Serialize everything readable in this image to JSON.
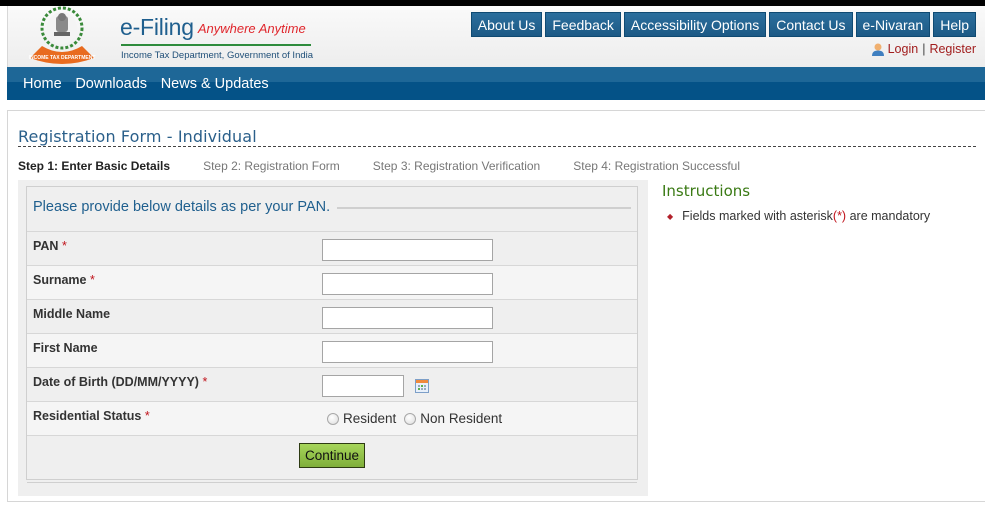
{
  "header": {
    "brand_title": "e-Filing",
    "brand_tagline": "Anywhere Anytime",
    "brand_subtitle": "Income Tax Department, Government of India",
    "emblem_text": "INCOME TAX DEPARTMENT",
    "top_links": [
      "About Us",
      "Feedback",
      "Accessibility Options",
      "Contact Us",
      "e-Nivaran",
      "Help"
    ],
    "login_label": "Login",
    "separator": "|",
    "register_label": "Register"
  },
  "nav": {
    "items": [
      "Home",
      "Downloads",
      "News & Updates"
    ]
  },
  "page": {
    "title": "Registration Form - Individual",
    "steps": [
      {
        "label": "Step 1: Enter Basic Details",
        "active": true
      },
      {
        "label": "Step 2: Registration Form",
        "active": false
      },
      {
        "label": "Step 3: Registration Verification",
        "active": false
      },
      {
        "label": "Step 4: Registration Successful",
        "active": false
      }
    ]
  },
  "form": {
    "legend": "Please provide below details as per your PAN.",
    "required_mark": "*",
    "fields": [
      {
        "label": "PAN",
        "required": true,
        "value": ""
      },
      {
        "label": "Surname",
        "required": true,
        "value": ""
      },
      {
        "label": "Middle Name",
        "required": false,
        "value": ""
      },
      {
        "label": "First Name",
        "required": false,
        "value": ""
      },
      {
        "label": "Date of Birth (DD/MM/YYYY)",
        "required": true,
        "value": ""
      }
    ],
    "residential_status": {
      "label": "Residential Status",
      "required": true,
      "options": [
        "Resident",
        "Non Resident"
      ],
      "selected": null
    },
    "submit_label": "Continue"
  },
  "instructions": {
    "title": "Instructions",
    "items": [
      {
        "before": "Fields marked with asterisk",
        "mark": "(*)",
        "after": " are mandatory"
      }
    ]
  },
  "colors": {
    "nav_blue": "#045287",
    "brand_blue": "#1f5f8e",
    "required_red": "#c0131b",
    "continue_green": "#8fbf46",
    "instructions_green": "#3a7a14"
  }
}
